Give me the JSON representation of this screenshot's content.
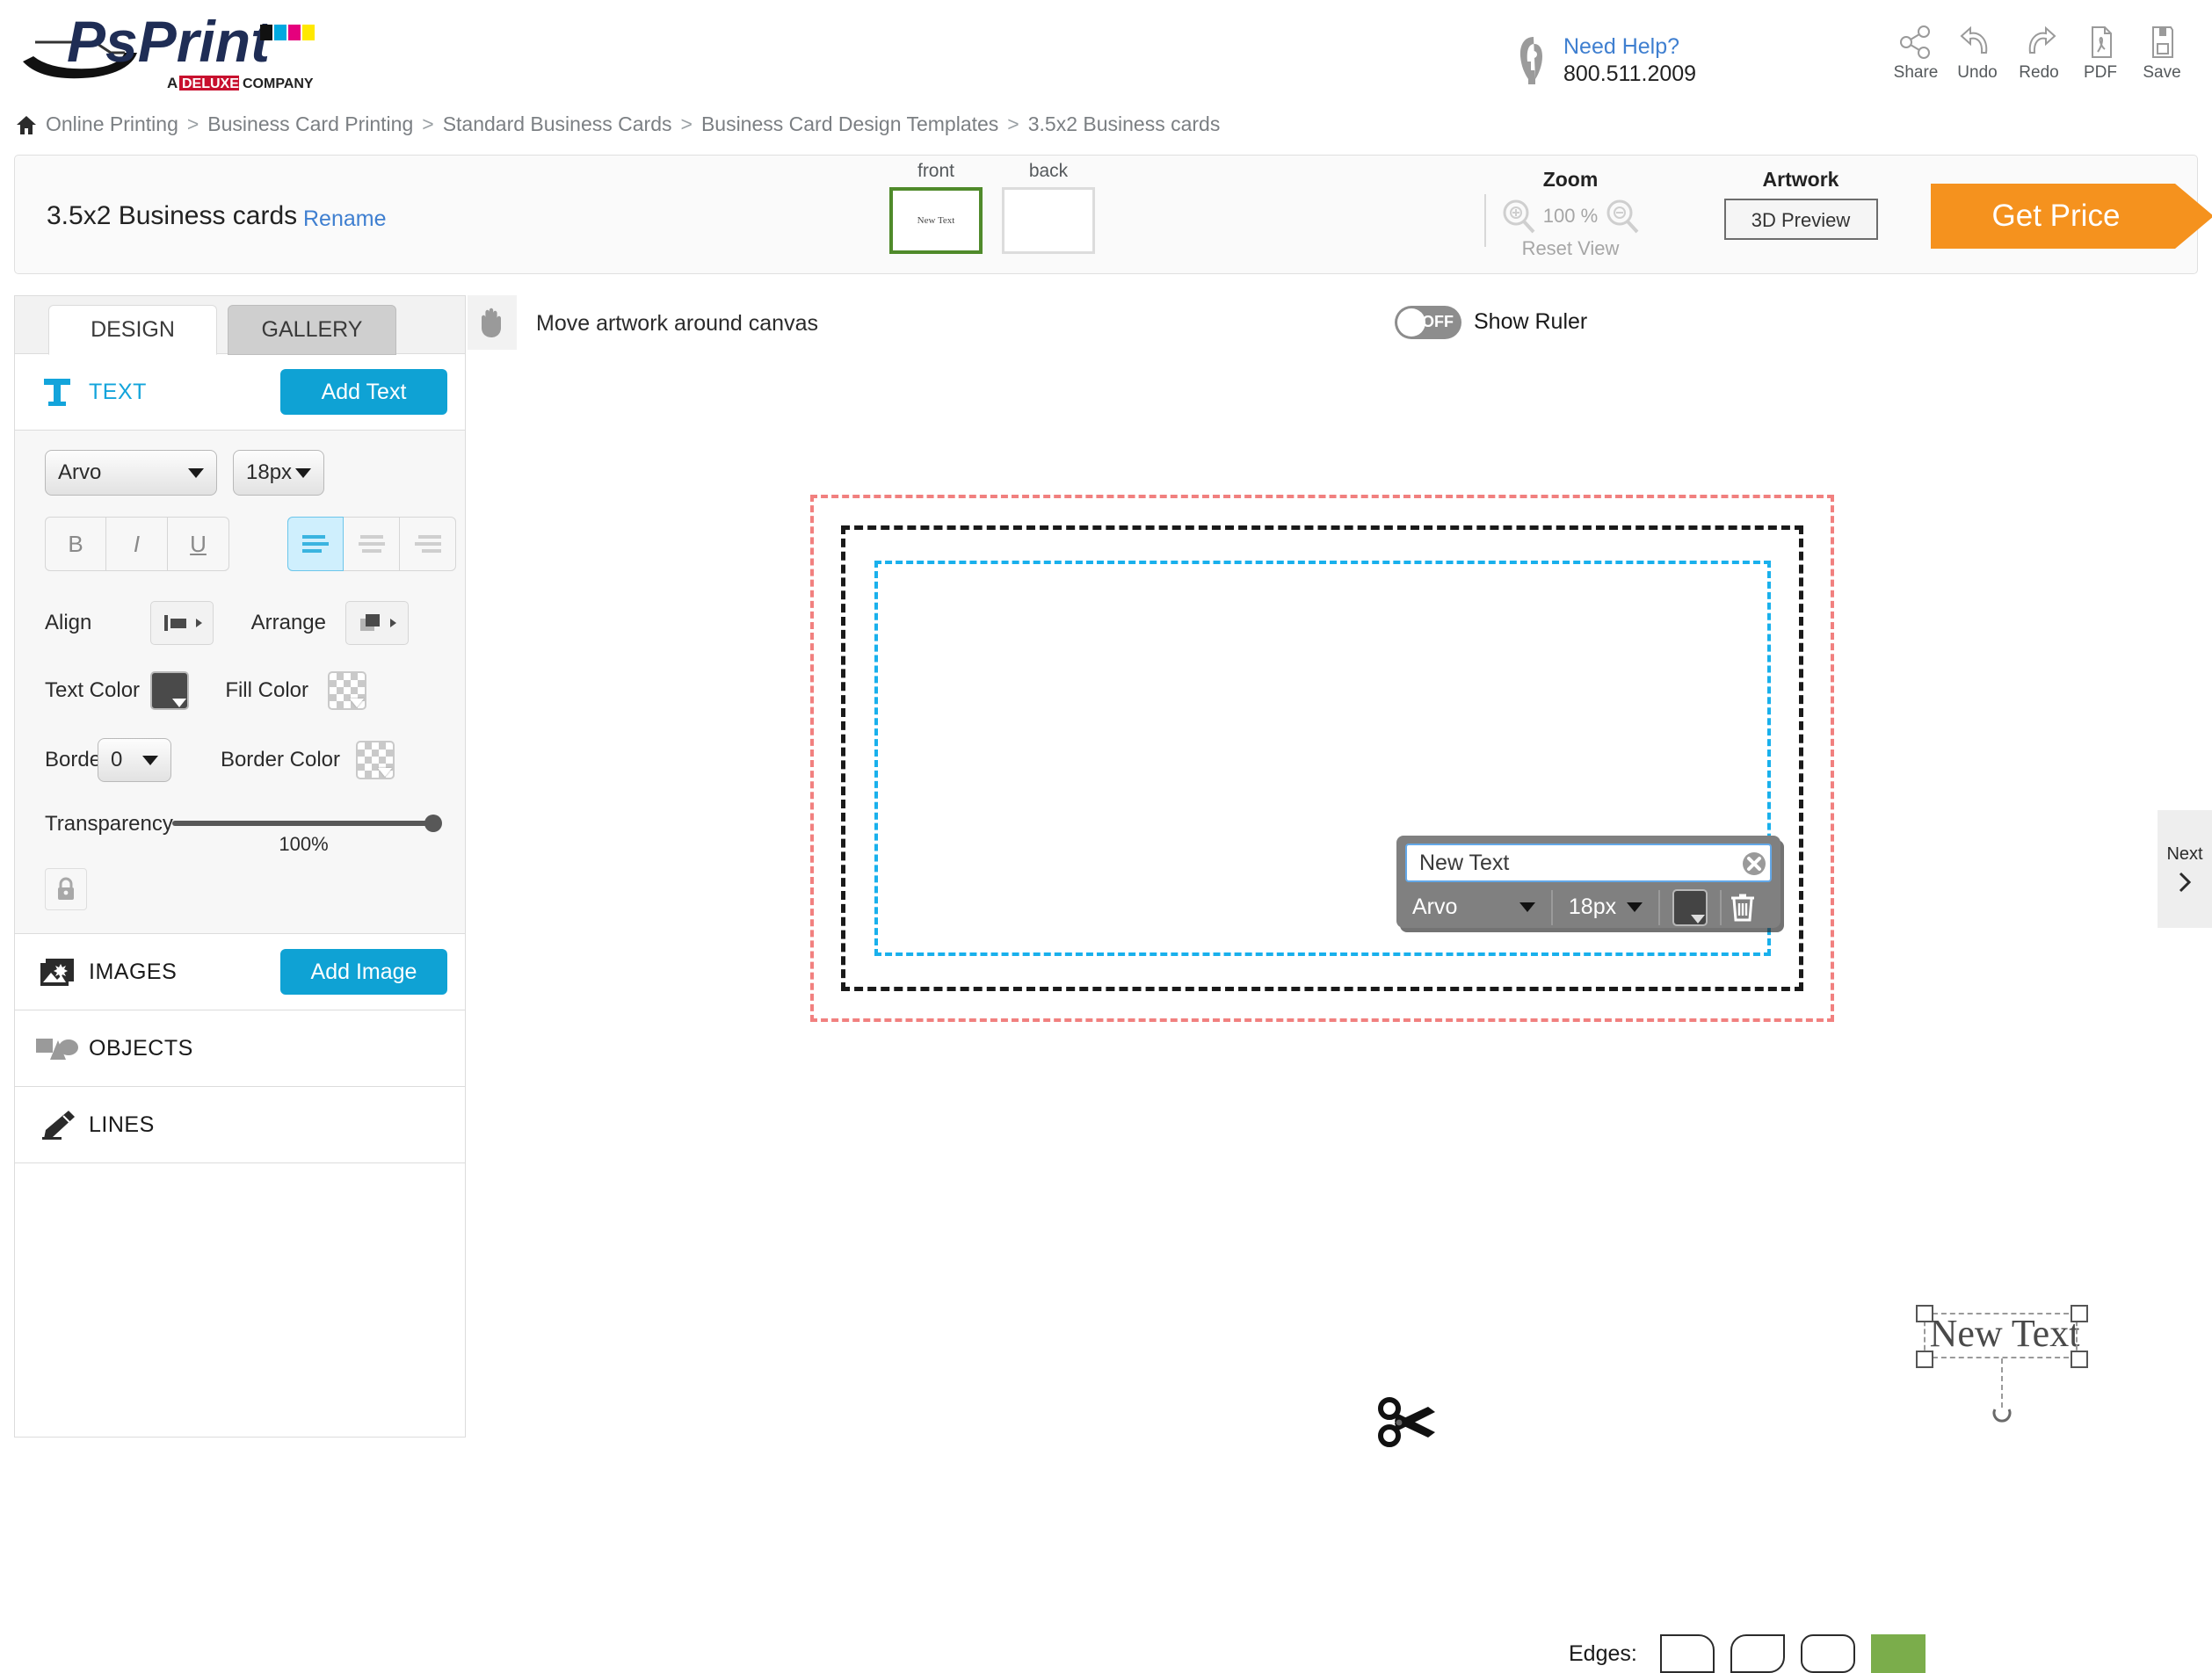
{
  "header": {
    "logo_main": "PsPrint",
    "logo_tagline_a": "A",
    "logo_tagline_deluxe": "DELUXE",
    "logo_tagline_company": "COMPANY",
    "help_title": "Need Help?",
    "help_phone": "800.511.2009",
    "tools": [
      {
        "label": "Share",
        "icon": "share-icon"
      },
      {
        "label": "Undo",
        "icon": "undo-icon"
      },
      {
        "label": "Redo",
        "icon": "redo-icon"
      },
      {
        "label": "PDF",
        "icon": "pdf-icon"
      },
      {
        "label": "Save",
        "icon": "save-icon"
      }
    ]
  },
  "breadcrumb": {
    "home_icon": "home-icon",
    "items": [
      "Online Printing",
      "Business Card Printing",
      "Standard Business Cards",
      "Business Card Design Templates",
      "3.5x2 Business cards"
    ],
    "separator": ">"
  },
  "projectbar": {
    "title": "3.5x2 Business cards",
    "rename": "Rename",
    "sides": [
      {
        "label": "front",
        "thumb_text": "New Text",
        "selected": true
      },
      {
        "label": "back",
        "thumb_text": "",
        "selected": false
      }
    ],
    "zoom_caption": "Zoom",
    "zoom_value": "100 %",
    "zoom_reset": "Reset View",
    "artwork_caption": "Artwork",
    "artwork_button": "3D Preview",
    "get_price": "Get Price"
  },
  "sidebar": {
    "tabs": [
      {
        "label": "DESIGN",
        "active": true
      },
      {
        "label": "GALLERY",
        "active": false
      }
    ],
    "text_section": {
      "icon": "text-t-icon",
      "label": "TEXT",
      "button": "Add Text"
    },
    "text_controls": {
      "font": "Arvo",
      "size": "18px",
      "bold": "B",
      "italic": "I",
      "underline": "U",
      "align_left_active": true,
      "align_label": "Align",
      "arrange_label": "Arrange",
      "text_color_label": "Text Color",
      "text_color_value": "#4a4a4a",
      "fill_color_label": "Fill Color",
      "fill_color_value": "transparent",
      "border_label": "Border",
      "border_value": "0",
      "border_color_label": "Border Color",
      "border_color_value": "transparent",
      "transparency_label": "Transparency",
      "transparency_value": "100%",
      "lock_icon": "lock-icon"
    },
    "images_section": {
      "icon": "image-icon",
      "label": "IMAGES",
      "button": "Add Image"
    },
    "objects_section": {
      "icon": "shapes-icon",
      "label": "OBJECTS"
    },
    "lines_section": {
      "icon": "pencil-icon",
      "label": "LINES"
    }
  },
  "canvas_toolbar": {
    "hand_icon": "hand-icon",
    "hand_label": "Move artwork around canvas",
    "ruler_toggle_state": "OFF",
    "ruler_label": "Show Ruler"
  },
  "canvas": {
    "text_object": "New Text",
    "scissors_icon": "scissors-icon",
    "rotate_icon": "rotate-icon",
    "guide_bleed_color": "#f1807f",
    "guide_cut_color": "#1a1a1a",
    "guide_safe_color": "#19b0ec"
  },
  "text_popup": {
    "value": "New Text",
    "placeholder": "New Text",
    "close_icon": "close-circle-icon",
    "font": "Arvo",
    "size": "18px",
    "color_value": "#444444",
    "delete_icon": "trash-icon"
  },
  "edges": {
    "label": "Edges:",
    "options": [
      {
        "name": "one-rounded-corner",
        "selected": false
      },
      {
        "name": "two-rounded-corners",
        "selected": false
      },
      {
        "name": "all-rounded-corners",
        "selected": false
      },
      {
        "name": "square-edges",
        "selected": true,
        "color": "#7bad4b"
      }
    ]
  },
  "next_tab": {
    "label": "Next",
    "icon": "chevron-right-icon"
  }
}
